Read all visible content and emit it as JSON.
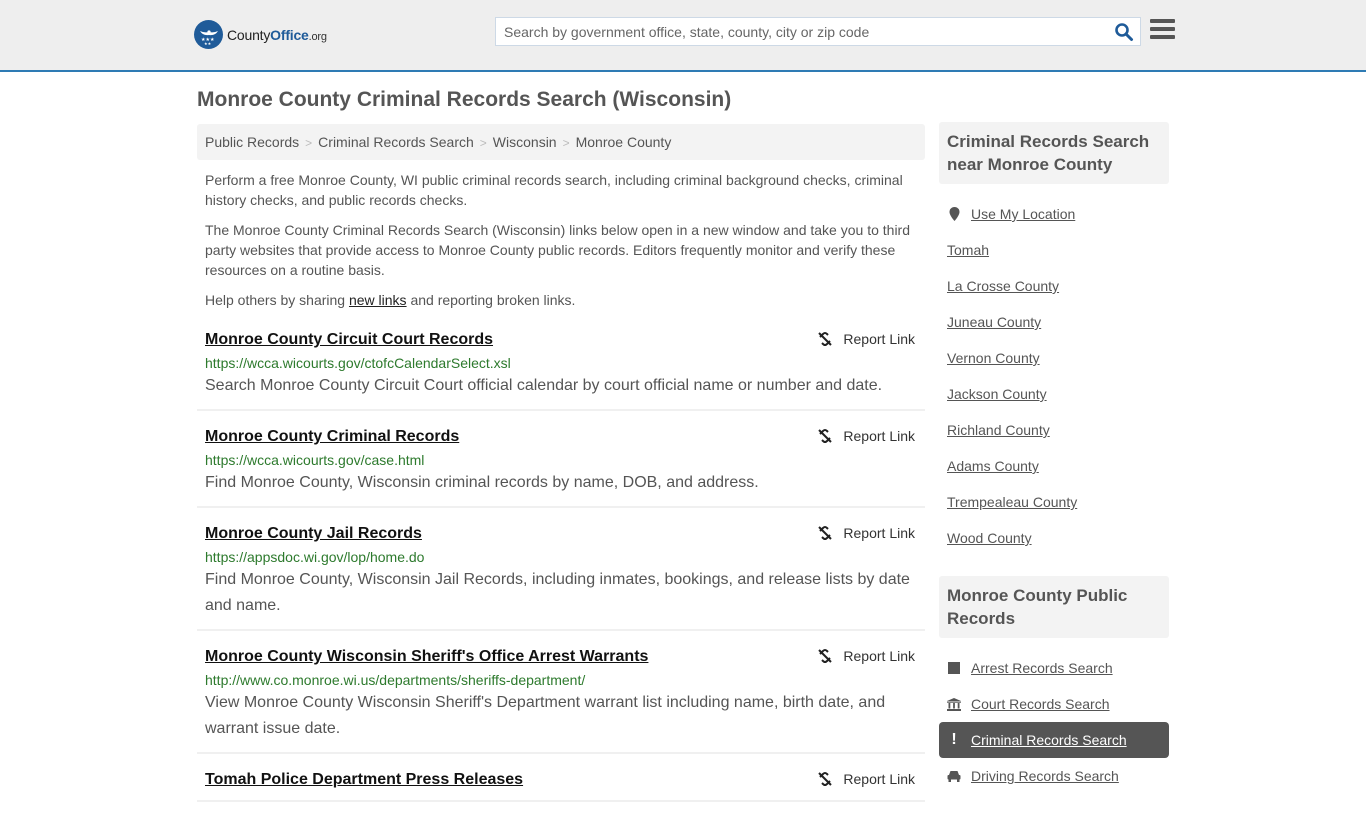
{
  "header": {
    "logo_main": "County",
    "logo_accent": "Office",
    "logo_suffix": ".org",
    "search_placeholder": "Search by government office, state, county, city or zip code",
    "search_icon": "search-icon",
    "menu_icon": "hamburger-menu-icon"
  },
  "page": {
    "title": "Monroe County Criminal Records Search (Wisconsin)"
  },
  "breadcrumb": [
    {
      "label": "Public Records"
    },
    {
      "label": "Criminal Records Search"
    },
    {
      "label": "Wisconsin"
    },
    {
      "label": "Monroe County"
    }
  ],
  "breadcrumb_separator": ">",
  "intro": {
    "p1": "Perform a free Monroe County, WI public criminal records search, including criminal background checks, criminal history checks, and public records checks.",
    "p2": "The Monroe County Criminal Records Search (Wisconsin) links below open in a new window and take you to third party websites that provide access to Monroe County public records. Editors frequently monitor and verify these resources on a routine basis.",
    "p3_before": "Help others by sharing ",
    "p3_link": "new links",
    "p3_after": " and reporting broken links."
  },
  "report_label": "Report Link",
  "results": [
    {
      "title": "Monroe County Circuit Court Records",
      "url": "https://wcca.wicourts.gov/ctofcCalendarSelect.xsl",
      "description": "Search Monroe County Circuit Court official calendar by court official name or number and date."
    },
    {
      "title": "Monroe County Criminal Records",
      "url": "https://wcca.wicourts.gov/case.html",
      "description": "Find Monroe County, Wisconsin criminal records by name, DOB, and address."
    },
    {
      "title": "Monroe County Jail Records",
      "url": "https://appsdoc.wi.gov/lop/home.do",
      "description": "Find Monroe County, Wisconsin Jail Records, including inmates, bookings, and release lists by date and name."
    },
    {
      "title": "Monroe County Wisconsin Sheriff's Office Arrest Warrants",
      "url": "http://www.co.monroe.wi.us/departments/sheriffs-department/",
      "description": "View Monroe County Wisconsin Sheriff's Department warrant list including name, birth date, and warrant issue date."
    },
    {
      "title": "Tomah Police Department Press Releases",
      "url": "",
      "description": ""
    }
  ],
  "sidebar": {
    "nearby": {
      "heading": "Criminal Records Search near Monroe County",
      "use_location": "Use My Location",
      "items": [
        "Tomah",
        "La Crosse County",
        "Juneau County",
        "Vernon County",
        "Jackson County",
        "Richland County",
        "Adams County",
        "Trempealeau County",
        "Wood County"
      ]
    },
    "public_records": {
      "heading": "Monroe County Public Records",
      "items": [
        {
          "label": "Arrest Records Search",
          "icon": "square-icon",
          "active": false
        },
        {
          "label": "Court Records Search",
          "icon": "courthouse-icon",
          "active": false
        },
        {
          "label": "Criminal Records Search",
          "icon": "exclamation-icon",
          "active": true
        },
        {
          "label": "Driving Records Search",
          "icon": "car-icon",
          "active": false
        }
      ]
    }
  },
  "colors": {
    "brand_blue": "#1f5b99",
    "header_border": "#2e7bb4",
    "url_green": "#2d7a2d",
    "active_bg": "#555555"
  }
}
